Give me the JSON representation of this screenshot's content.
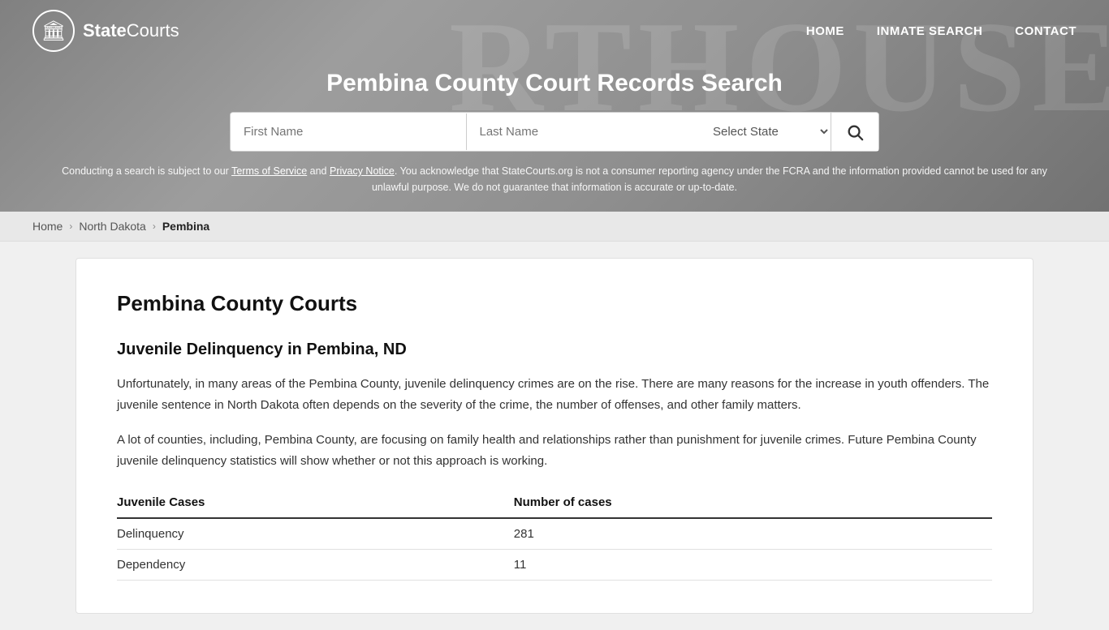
{
  "site": {
    "logo_text_bold": "State",
    "logo_text_light": "Courts",
    "logo_icon": "🏛"
  },
  "nav": {
    "links": [
      {
        "label": "HOME",
        "href": "#"
      },
      {
        "label": "INMATE SEARCH",
        "href": "#"
      },
      {
        "label": "CONTACT",
        "href": "#"
      }
    ]
  },
  "header": {
    "title": "Pembina County Court Records Search",
    "search": {
      "first_name_placeholder": "First Name",
      "last_name_placeholder": "Last Name",
      "state_label": "Select State",
      "search_icon": "🔍"
    },
    "disclaimer": "Conducting a search is subject to our Terms of Service and Privacy Notice. You acknowledge that StateCourts.org is not a consumer reporting agency under the FCRA and the information provided cannot be used for any unlawful purpose. We do not guarantee that information is accurate or up-to-date."
  },
  "breadcrumb": {
    "home": "Home",
    "state": "North Dakota",
    "county": "Pembina"
  },
  "content": {
    "county_title": "Pembina County Courts",
    "section_title": "Juvenile Delinquency in Pembina, ND",
    "paragraph1": "Unfortunately, in many areas of the Pembina County, juvenile delinquency crimes are on the rise. There are many reasons for the increase in youth offenders. The juvenile sentence in North Dakota often depends on the severity of the crime, the number of offenses, and other family matters.",
    "paragraph2": "A lot of counties, including, Pembina County, are focusing on family health and relationships rather than punishment for juvenile crimes. Future Pembina County juvenile delinquency statistics will show whether or not this approach is working.",
    "table": {
      "col1_header": "Juvenile Cases",
      "col2_header": "Number of cases",
      "rows": [
        {
          "case_type": "Delinquency",
          "count": "281"
        },
        {
          "case_type": "Dependency",
          "count": "11"
        }
      ]
    }
  }
}
